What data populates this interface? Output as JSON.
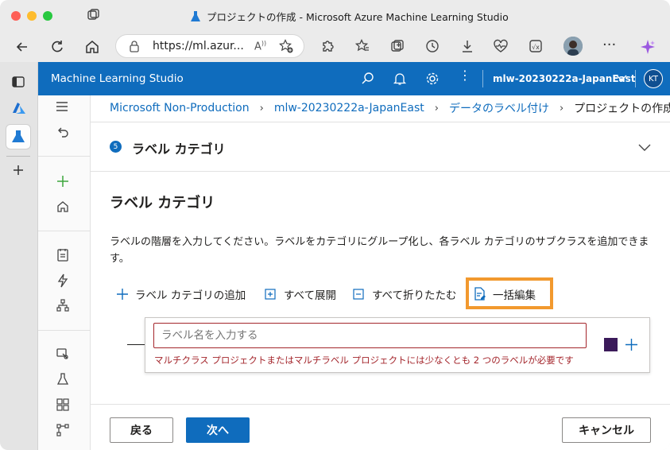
{
  "window": {
    "title": "プロジェクトの作成 - Microsoft Azure Machine Learning Studio"
  },
  "browser": {
    "url": "https://ml.azur...",
    "avatar_initials": "KT"
  },
  "app": {
    "name": "Machine Learning Studio",
    "workspace": "mlw-20230222a-JapanEast",
    "user_initials": "KT",
    "accent": "#0f6cbd"
  },
  "breadcrumb": {
    "items": [
      "Microsoft Non-Production",
      "mlw-20230222a-JapanEast",
      "データのラベル付け"
    ],
    "current": "プロジェクトの作成"
  },
  "step": {
    "number": "5",
    "title": "ラベル カテゴリ"
  },
  "section": {
    "heading": "ラベル カテゴリ",
    "description": "ラベルの階層を入力してください。ラベルをカテゴリにグループ化し、各ラベル カテゴリのサブクラスを追加できます。"
  },
  "toolbar": {
    "add_category": "ラベル カテゴリの追加",
    "expand_all": "すべて展開",
    "collapse_all": "すべて折りたたむ",
    "bulk_edit": "一括編集",
    "highlight_color": "#f2992e"
  },
  "label_editor": {
    "placeholder": "ラベル名を入力する",
    "value": "",
    "error": "マルチクラス プロジェクトまたはマルチラベル プロジェクトには少なくとも 2 つのラベルが必要です",
    "swatch_color": "#3b1a5a",
    "error_color": "#a4262c"
  },
  "footer": {
    "back": "戻る",
    "next": "次へ",
    "cancel": "キャンセル"
  }
}
